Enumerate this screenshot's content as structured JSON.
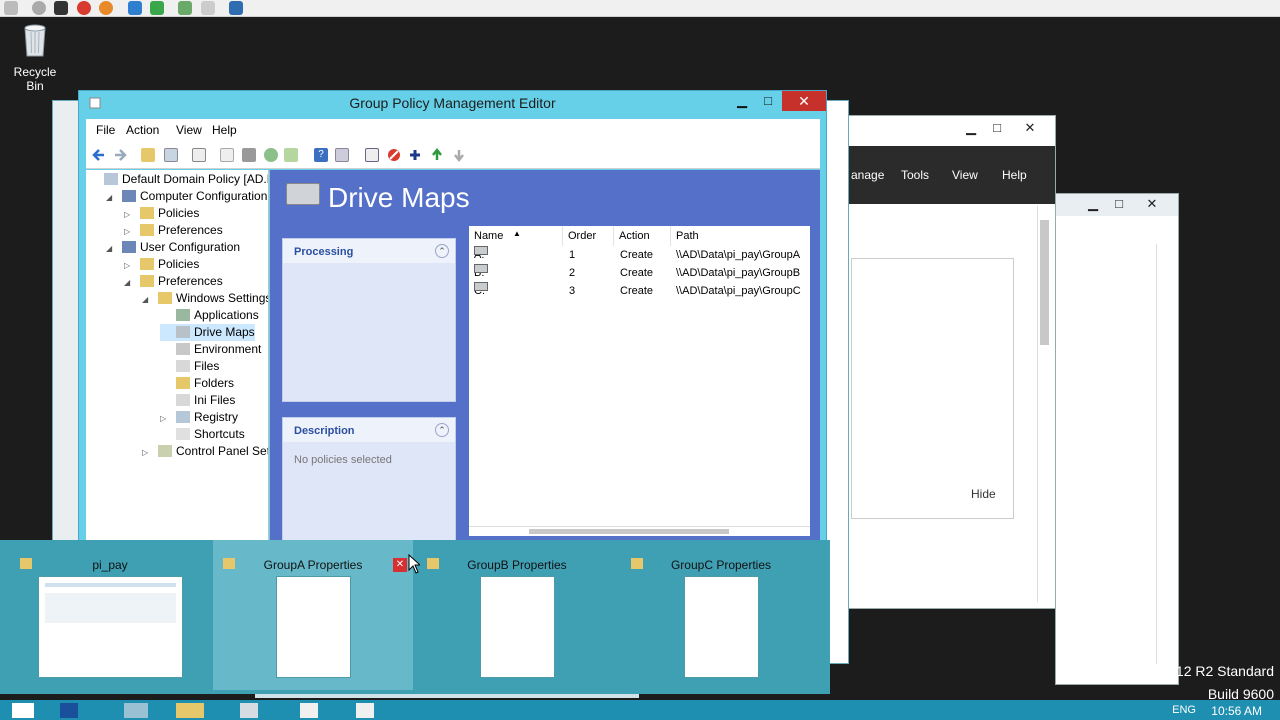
{
  "desktop": {
    "recycle_bin": "Recycle Bin"
  },
  "main_window": {
    "title": "Group Policy Management Editor",
    "menu": [
      "File",
      "Action",
      "View",
      "Help"
    ],
    "tree": [
      {
        "label": "Default Domain Policy [AD.KG_",
        "depth": 0,
        "expander": ""
      },
      {
        "label": "Computer Configuration",
        "depth": 1,
        "expander": "◢"
      },
      {
        "label": "Policies",
        "depth": 2,
        "expander": "▷"
      },
      {
        "label": "Preferences",
        "depth": 2,
        "expander": "▷"
      },
      {
        "label": "User Configuration",
        "depth": 1,
        "expander": "◢"
      },
      {
        "label": "Policies",
        "depth": 2,
        "expander": "▷"
      },
      {
        "label": "Preferences",
        "depth": 2,
        "expander": "◢"
      },
      {
        "label": "Windows Settings",
        "depth": 3,
        "expander": "◢"
      },
      {
        "label": "Applications",
        "depth": 4,
        "expander": ""
      },
      {
        "label": "Drive Maps",
        "depth": 4,
        "expander": ""
      },
      {
        "label": "Environment",
        "depth": 4,
        "expander": ""
      },
      {
        "label": "Files",
        "depth": 4,
        "expander": ""
      },
      {
        "label": "Folders",
        "depth": 4,
        "expander": ""
      },
      {
        "label": "Ini Files",
        "depth": 4,
        "expander": ""
      },
      {
        "label": "Registry",
        "depth": 4,
        "expander": "▷"
      },
      {
        "label": "Shortcuts",
        "depth": 4,
        "expander": ""
      },
      {
        "label": "Control Panel Setting",
        "depth": 3,
        "expander": "▷"
      }
    ],
    "header": "Drive Maps",
    "processing_panel": {
      "title": "Processing"
    },
    "description_panel": {
      "title": "Description",
      "body": "No policies selected"
    },
    "columns": [
      "Name",
      "Order",
      "Action",
      "Path"
    ],
    "rows": [
      {
        "name": "A:",
        "order": "1",
        "action": "Create",
        "path": "\\\\AD\\Data\\pi_pay\\GroupA"
      },
      {
        "name": "B:",
        "order": "2",
        "action": "Create",
        "path": "\\\\AD\\Data\\pi_pay\\GroupB"
      },
      {
        "name": "C:",
        "order": "3",
        "action": "Create",
        "path": "\\\\AD\\Data\\pi_pay\\GroupC"
      }
    ]
  },
  "background_window": {
    "menu": [
      "anage",
      "Tools",
      "View",
      "Help"
    ],
    "hide_label": "Hide"
  },
  "thumbnails": [
    {
      "label": "pi_pay"
    },
    {
      "label": "GroupA Properties"
    },
    {
      "label": "GroupB Properties"
    },
    {
      "label": "GroupC Properties"
    }
  ],
  "os_text": {
    "line1": "12 R2 Standard",
    "line2": "Build 9600"
  },
  "taskbar": {
    "lang": "ENG",
    "clock": "10:56 AM"
  },
  "colors": {
    "accent": "#66d0e8",
    "content_bg": "#5570c8",
    "taskbar": "#1e8fb0",
    "close": "#c7312b"
  }
}
